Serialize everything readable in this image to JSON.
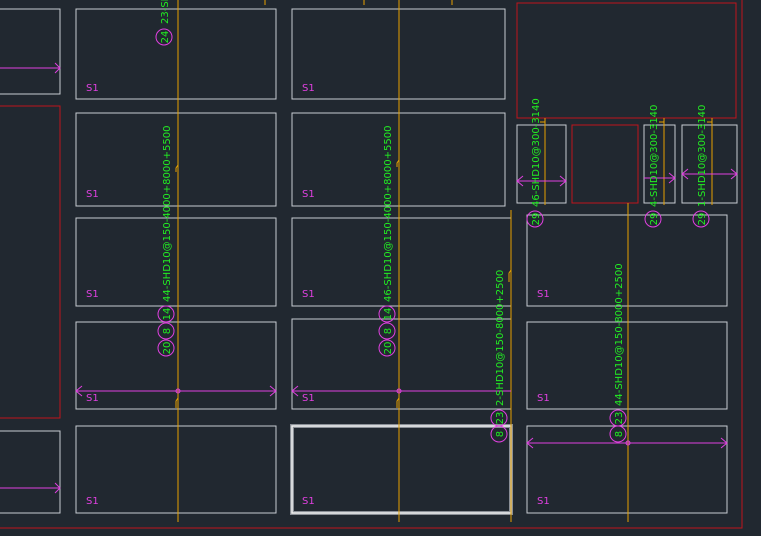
{
  "colors": {
    "background": "#212830",
    "slab_outline": "#c8ccd2",
    "beam_red": "#c0141c",
    "rebar_yellow": "#e6a100",
    "dimension_magenta": "#e040e0",
    "text_green": "#22ee22",
    "selected_outline": "#f0f0f0"
  },
  "slab_label": "S1",
  "rebar_labels": {
    "col1_top": "23-SHD",
    "col1_main": "44-SHD10@150-4000+8000+5500",
    "col2_main": "46-SHD10@150-4000+8000+5500",
    "col3_main": "2-SHD10@150-8000+2500",
    "col4_main": "44-SHD10@150-8000+2500",
    "small1": "46-SHD10@300-3140",
    "small2": "4-SHD10@300-3140",
    "small3": "1-SHD10@300-3140"
  },
  "circle_numbers": {
    "c24": "24",
    "c14a": "14",
    "c8a": "8",
    "c20a": "20",
    "c14b": "14",
    "c8b": "8",
    "c20b": "20",
    "c29a": "29",
    "c29b": "29",
    "c29c": "29",
    "c23a": "23",
    "c8c": "8",
    "c23b": "23",
    "c8d": "8"
  }
}
